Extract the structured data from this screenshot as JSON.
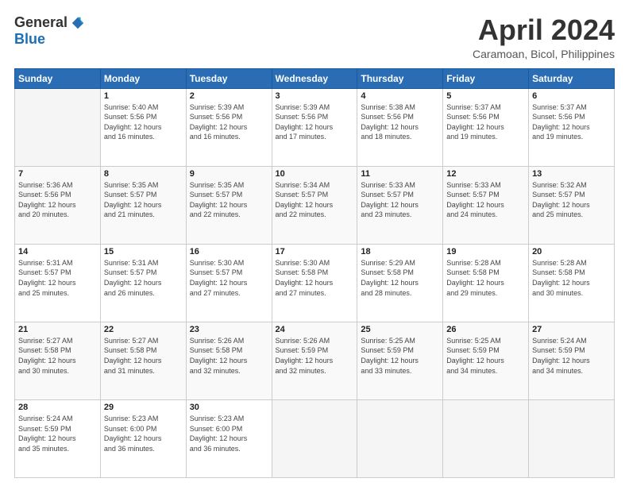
{
  "logo": {
    "general": "General",
    "blue": "Blue"
  },
  "title": "April 2024",
  "location": "Caramoan, Bicol, Philippines",
  "days_header": [
    "Sunday",
    "Monday",
    "Tuesday",
    "Wednesday",
    "Thursday",
    "Friday",
    "Saturday"
  ],
  "weeks": [
    [
      {
        "day": "",
        "info": ""
      },
      {
        "day": "1",
        "info": "Sunrise: 5:40 AM\nSunset: 5:56 PM\nDaylight: 12 hours\nand 16 minutes."
      },
      {
        "day": "2",
        "info": "Sunrise: 5:39 AM\nSunset: 5:56 PM\nDaylight: 12 hours\nand 16 minutes."
      },
      {
        "day": "3",
        "info": "Sunrise: 5:39 AM\nSunset: 5:56 PM\nDaylight: 12 hours\nand 17 minutes."
      },
      {
        "day": "4",
        "info": "Sunrise: 5:38 AM\nSunset: 5:56 PM\nDaylight: 12 hours\nand 18 minutes."
      },
      {
        "day": "5",
        "info": "Sunrise: 5:37 AM\nSunset: 5:56 PM\nDaylight: 12 hours\nand 19 minutes."
      },
      {
        "day": "6",
        "info": "Sunrise: 5:37 AM\nSunset: 5:56 PM\nDaylight: 12 hours\nand 19 minutes."
      }
    ],
    [
      {
        "day": "7",
        "info": "Sunrise: 5:36 AM\nSunset: 5:56 PM\nDaylight: 12 hours\nand 20 minutes."
      },
      {
        "day": "8",
        "info": "Sunrise: 5:35 AM\nSunset: 5:57 PM\nDaylight: 12 hours\nand 21 minutes."
      },
      {
        "day": "9",
        "info": "Sunrise: 5:35 AM\nSunset: 5:57 PM\nDaylight: 12 hours\nand 22 minutes."
      },
      {
        "day": "10",
        "info": "Sunrise: 5:34 AM\nSunset: 5:57 PM\nDaylight: 12 hours\nand 22 minutes."
      },
      {
        "day": "11",
        "info": "Sunrise: 5:33 AM\nSunset: 5:57 PM\nDaylight: 12 hours\nand 23 minutes."
      },
      {
        "day": "12",
        "info": "Sunrise: 5:33 AM\nSunset: 5:57 PM\nDaylight: 12 hours\nand 24 minutes."
      },
      {
        "day": "13",
        "info": "Sunrise: 5:32 AM\nSunset: 5:57 PM\nDaylight: 12 hours\nand 25 minutes."
      }
    ],
    [
      {
        "day": "14",
        "info": "Sunrise: 5:31 AM\nSunset: 5:57 PM\nDaylight: 12 hours\nand 25 minutes."
      },
      {
        "day": "15",
        "info": "Sunrise: 5:31 AM\nSunset: 5:57 PM\nDaylight: 12 hours\nand 26 minutes."
      },
      {
        "day": "16",
        "info": "Sunrise: 5:30 AM\nSunset: 5:57 PM\nDaylight: 12 hours\nand 27 minutes."
      },
      {
        "day": "17",
        "info": "Sunrise: 5:30 AM\nSunset: 5:58 PM\nDaylight: 12 hours\nand 27 minutes."
      },
      {
        "day": "18",
        "info": "Sunrise: 5:29 AM\nSunset: 5:58 PM\nDaylight: 12 hours\nand 28 minutes."
      },
      {
        "day": "19",
        "info": "Sunrise: 5:28 AM\nSunset: 5:58 PM\nDaylight: 12 hours\nand 29 minutes."
      },
      {
        "day": "20",
        "info": "Sunrise: 5:28 AM\nSunset: 5:58 PM\nDaylight: 12 hours\nand 30 minutes."
      }
    ],
    [
      {
        "day": "21",
        "info": "Sunrise: 5:27 AM\nSunset: 5:58 PM\nDaylight: 12 hours\nand 30 minutes."
      },
      {
        "day": "22",
        "info": "Sunrise: 5:27 AM\nSunset: 5:58 PM\nDaylight: 12 hours\nand 31 minutes."
      },
      {
        "day": "23",
        "info": "Sunrise: 5:26 AM\nSunset: 5:58 PM\nDaylight: 12 hours\nand 32 minutes."
      },
      {
        "day": "24",
        "info": "Sunrise: 5:26 AM\nSunset: 5:59 PM\nDaylight: 12 hours\nand 32 minutes."
      },
      {
        "day": "25",
        "info": "Sunrise: 5:25 AM\nSunset: 5:59 PM\nDaylight: 12 hours\nand 33 minutes."
      },
      {
        "day": "26",
        "info": "Sunrise: 5:25 AM\nSunset: 5:59 PM\nDaylight: 12 hours\nand 34 minutes."
      },
      {
        "day": "27",
        "info": "Sunrise: 5:24 AM\nSunset: 5:59 PM\nDaylight: 12 hours\nand 34 minutes."
      }
    ],
    [
      {
        "day": "28",
        "info": "Sunrise: 5:24 AM\nSunset: 5:59 PM\nDaylight: 12 hours\nand 35 minutes."
      },
      {
        "day": "29",
        "info": "Sunrise: 5:23 AM\nSunset: 6:00 PM\nDaylight: 12 hours\nand 36 minutes."
      },
      {
        "day": "30",
        "info": "Sunrise: 5:23 AM\nSunset: 6:00 PM\nDaylight: 12 hours\nand 36 minutes."
      },
      {
        "day": "",
        "info": ""
      },
      {
        "day": "",
        "info": ""
      },
      {
        "day": "",
        "info": ""
      },
      {
        "day": "",
        "info": ""
      }
    ]
  ]
}
